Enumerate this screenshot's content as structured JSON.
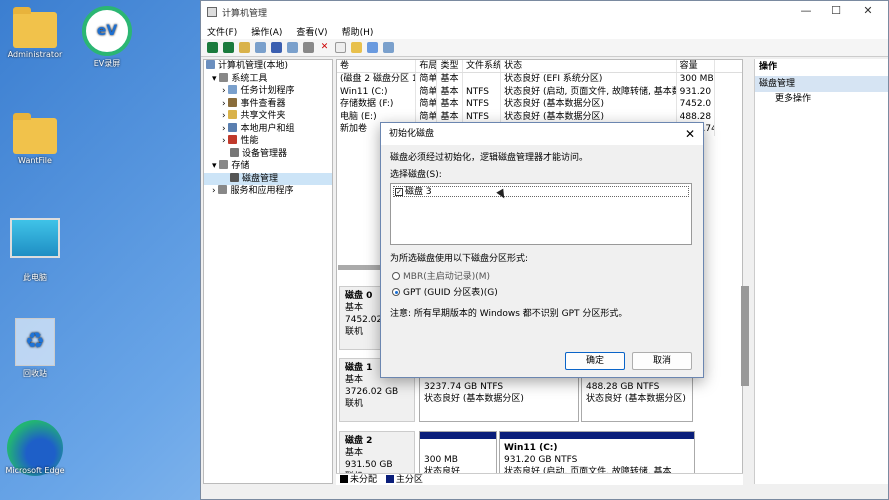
{
  "desktop": {
    "icons": [
      "Administrator",
      "EV录屏",
      "WantFile",
      "此电脑",
      "回收站",
      "Microsoft Edge"
    ]
  },
  "window": {
    "title": "计算机管理",
    "controls": [
      "—",
      "☐",
      "✕"
    ]
  },
  "menu": [
    "文件(F)",
    "操作(A)",
    "查看(V)",
    "帮助(H)"
  ],
  "tree": [
    "计算机管理(本地)",
    "系统工具",
    "任务计划程序",
    "事件查看器",
    "共享文件夹",
    "本地用户和组",
    "性能",
    "设备管理器",
    "存储",
    "磁盘管理",
    "服务和应用程序"
  ],
  "volumes": {
    "headers": [
      "卷",
      "布局",
      "类型",
      "文件系统",
      "状态",
      "容量",
      ""
    ],
    "rows": [
      [
        "(磁盘 2 磁盘分区 1)",
        "简单",
        "基本",
        "",
        "状态良好 (EFI 系统分区)",
        "300 MB",
        ""
      ],
      [
        "Win11 (C:)",
        "简单",
        "基本",
        "NTFS",
        "状态良好 (启动, 页面文件, 故障转储, 基本数据分区)",
        "931.20",
        ""
      ],
      [
        "存储数据 (F:)",
        "简单",
        "基本",
        "NTFS",
        "状态良好 (基本数据分区)",
        "7452.0",
        ""
      ],
      [
        "电脑 (E:)",
        "简单",
        "基本",
        "NTFS",
        "状态良好 (基本数据分区)",
        "488.28",
        ""
      ],
      [
        "新加卷",
        "",
        "",
        "",
        "",
        "3237.74",
        ""
      ]
    ]
  },
  "disks": [
    {
      "name": "磁盘 0",
      "type": "基本",
      "size": "7452.02 G",
      "status": "联机"
    },
    {
      "name": "磁盘 1",
      "type": "基本",
      "size": "3726.02 GB",
      "status": "联机",
      "parts": [
        {
          "l1": "3237.74 GB NTFS",
          "l2": "状态良好 (基本数据分区)"
        },
        {
          "l1": "488.28 GB NTFS",
          "l2": "状态良好 (基本数据分区)"
        }
      ]
    },
    {
      "name": "磁盘 2",
      "type": "基本",
      "size": "931.50 GB",
      "status": "联机",
      "parts": [
        {
          "l1": "300 MB",
          "l2": "状态良好"
        },
        {
          "title": "Win11  (C:)",
          "l1": "931.20 GB NTFS",
          "l2": "状态良好 (启动, 页面文件, 故障转储, 基本"
        }
      ]
    }
  ],
  "legend": [
    "未分配",
    "主分区"
  ],
  "actions": {
    "header": "操作",
    "section": "磁盘管理",
    "item": "更多操作"
  },
  "dialog": {
    "title": "初始化磁盘",
    "intro": "磁盘必须经过初始化，逻辑磁盘管理器才能访问。",
    "select_label": "选择磁盘(S):",
    "disk_item": "磁盘 3",
    "style_label": "为所选磁盘使用以下磁盘分区形式:",
    "mbr": "MBR(主启动记录)(M)",
    "gpt": "GPT (GUID 分区表)(G)",
    "note": "注意: 所有早期版本的 Windows 都不识别 GPT 分区形式。",
    "ok": "确定",
    "cancel": "取消"
  }
}
